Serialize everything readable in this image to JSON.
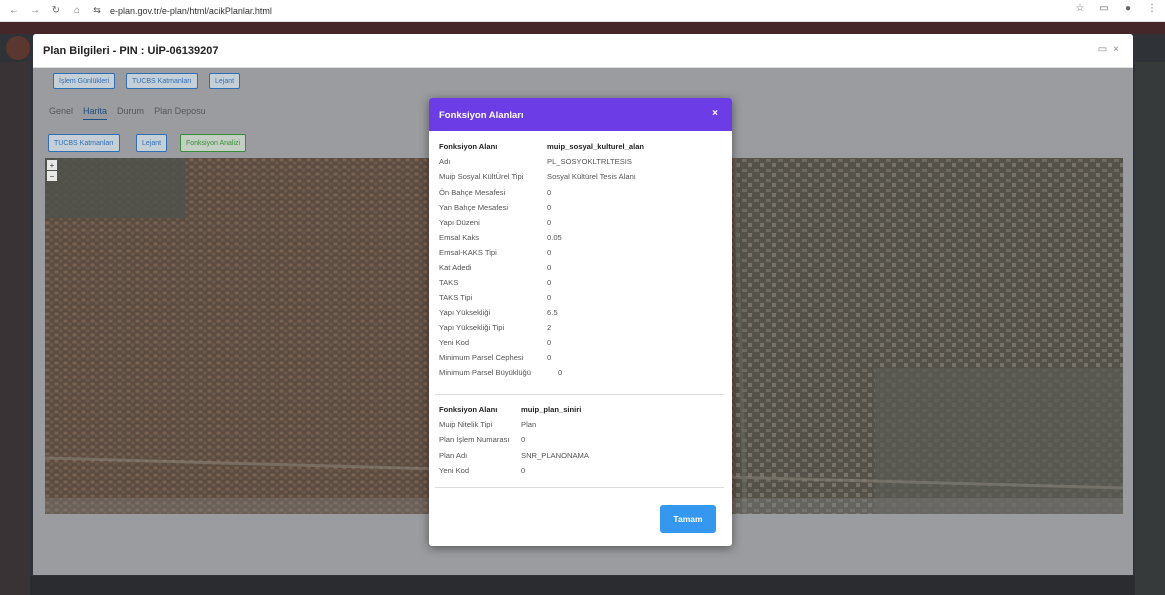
{
  "browser": {
    "url": "e-plan.gov.tr/e-plan/html/acikPlanlar.html",
    "back_icon": "arrow-left-icon",
    "forward_icon": "arrow-right-icon",
    "reload_icon": "reload-icon",
    "home_icon": "home-icon"
  },
  "panel": {
    "title": "Plan Bilgileri - PIN : UİP-06139207",
    "top_buttons": [
      "İşlem Günlükleri",
      "TUCBS Katmanları",
      "Lejant"
    ],
    "tabs": [
      "Genel",
      "Harita",
      "Durum",
      "Plan Deposu"
    ],
    "active_tab": "Harita",
    "map_buttons": [
      "TUCBS Katmanları",
      "Lejant",
      "Fonksiyon Analizi"
    ],
    "zoom_in": "+",
    "zoom_out": "−"
  },
  "dialog": {
    "title": "Fonksiyon Alanları",
    "close": "×",
    "group1": {
      "header_key": "Fonksiyon Alanı",
      "header_value": "muip_sosyal_kulturel_alan",
      "rows": [
        {
          "k": "Adı",
          "v": "PL_SOSYOKLTRLTESIS"
        },
        {
          "k": "Muip Sosyal KültÜrel Tipi",
          "v": "Sosyal Kültürel Tesis Alanı"
        },
        {
          "k": "Ön Bahçe Mesafesi",
          "v": "0"
        },
        {
          "k": "Yan Bahçe Mesafesi",
          "v": "0"
        },
        {
          "k": "Yapı Düzeni",
          "v": "0"
        },
        {
          "k": "Emsal Kaks",
          "v": "0.05"
        },
        {
          "k": "Emsal-KAKS Tipi",
          "v": "0"
        },
        {
          "k": "Kat Adedi",
          "v": "0"
        },
        {
          "k": "TAKS",
          "v": "0"
        },
        {
          "k": "TAKS Tipi",
          "v": "0"
        },
        {
          "k": "Yapı Yüksekliği",
          "v": "6.5"
        },
        {
          "k": "Yapı Yüksekliği Tipi",
          "v": "2"
        },
        {
          "k": "Yeni Kod",
          "v": "0"
        },
        {
          "k": "Minimum Parsel Cephesi",
          "v": "0"
        },
        {
          "k": "Minimum Parsel Büyüklüğü",
          "v": "0"
        }
      ]
    },
    "group2": {
      "header_key": "Fonksiyon Alanı",
      "header_value": "muip_plan_siniri",
      "rows": [
        {
          "k": "Muip Nitelik Tipi",
          "v": "Plan"
        },
        {
          "k": "Plan İşlem Numarası",
          "v": "0"
        },
        {
          "k": "Plan Adı",
          "v": "SNR_PLANONAMA"
        },
        {
          "k": "Yeni Kod",
          "v": "0"
        }
      ]
    },
    "ok_label": "Tamam"
  }
}
